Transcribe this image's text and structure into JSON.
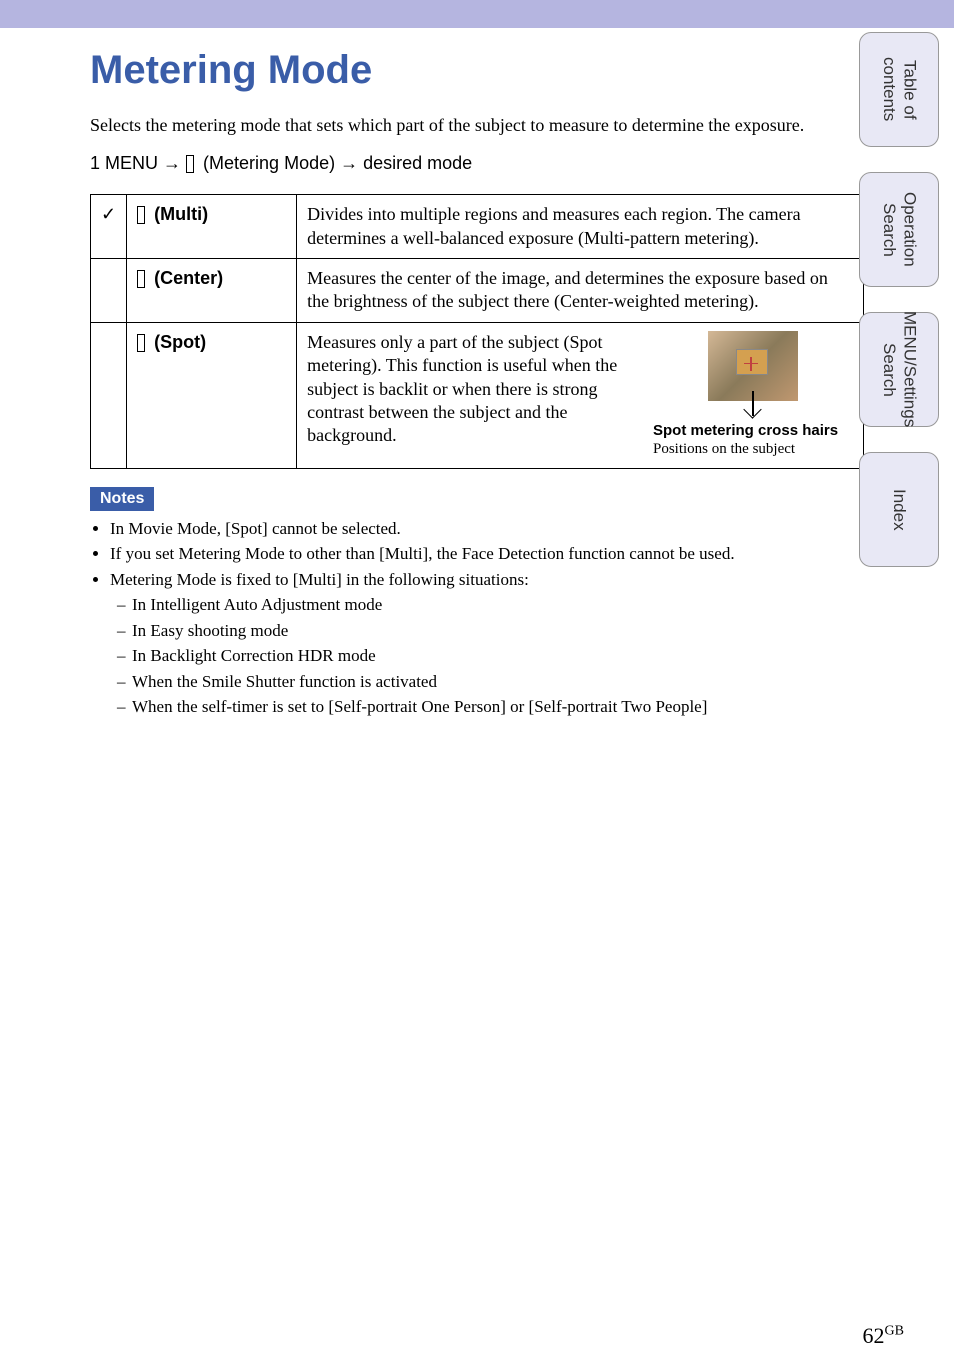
{
  "title": "Metering Mode",
  "intro": "Selects the metering mode that sets which part of the subject to measure to determine the exposure.",
  "menu_step": "1 MENU →",
  "menu_step_mid": " (Metering Mode) → desired mode",
  "table": {
    "rows": [
      {
        "check": "✓",
        "label": " (Multi)",
        "desc": "Divides into multiple regions and measures each region. The camera determines a well-balanced exposure (Multi-pattern metering)."
      },
      {
        "check": "",
        "label": " (Center)",
        "desc": "Measures the center of the image, and determines the exposure based on the brightness of the subject there (Center-weighted metering)."
      },
      {
        "check": "",
        "label": " (Spot)",
        "desc": "Measures only a part of the subject (Spot metering). This function is useful when the subject is backlit or when there is strong contrast between the subject and the background.",
        "caption_bold": "Spot metering cross hairs",
        "caption": "Positions on the subject"
      }
    ]
  },
  "notes_label": "Notes",
  "notes": [
    "In Movie Mode, [Spot] cannot be selected.",
    "If you set Metering Mode to other than [Multi], the Face Detection function cannot be used.",
    "Metering Mode is fixed to [Multi] in the following situations:"
  ],
  "sub_notes": [
    "In Intelligent Auto Adjustment mode",
    "In Easy shooting mode",
    "In Backlight Correction HDR mode",
    "When the Smile Shutter function is activated",
    "When the self-timer is set to [Self-portrait One Person] or [Self-portrait Two People]"
  ],
  "tabs": [
    "Table of contents",
    "Operation Search",
    "MENU/Settings Search",
    "Index"
  ],
  "page": "62",
  "page_suffix": "GB"
}
